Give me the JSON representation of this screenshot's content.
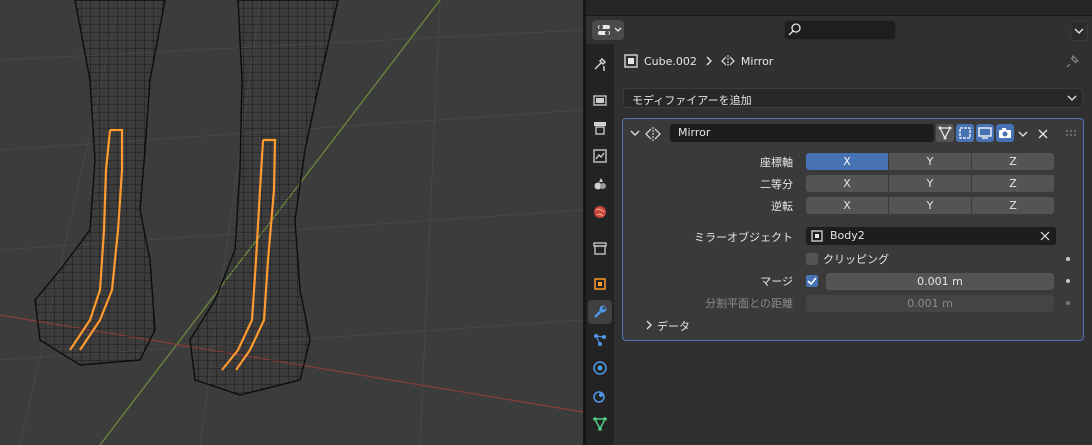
{
  "breadcrumb": {
    "object": "Cube.002",
    "modifier": "Mirror"
  },
  "add_modifier_label": "モディファイアーを追加",
  "search": {
    "placeholder": ""
  },
  "modifier": {
    "name": "Mirror",
    "axis_label": "座標軸",
    "bisect_label": "二等分",
    "flip_label": "逆転",
    "axis_options": [
      "X",
      "Y",
      "Z"
    ],
    "mirror_object_label": "ミラーオブジェクト",
    "mirror_object_value": "Body2",
    "clipping_label": "クリッピング",
    "merge_label": "マージ",
    "merge_value": "0.001 m",
    "bisect_distance_label": "分割平面との距離",
    "bisect_distance_value": "0.001 m",
    "data_subpanel": "データ"
  },
  "colors": {
    "accent": "#4772b3",
    "active_outline": "#4f76b8",
    "selection": "#ff9a2e"
  }
}
